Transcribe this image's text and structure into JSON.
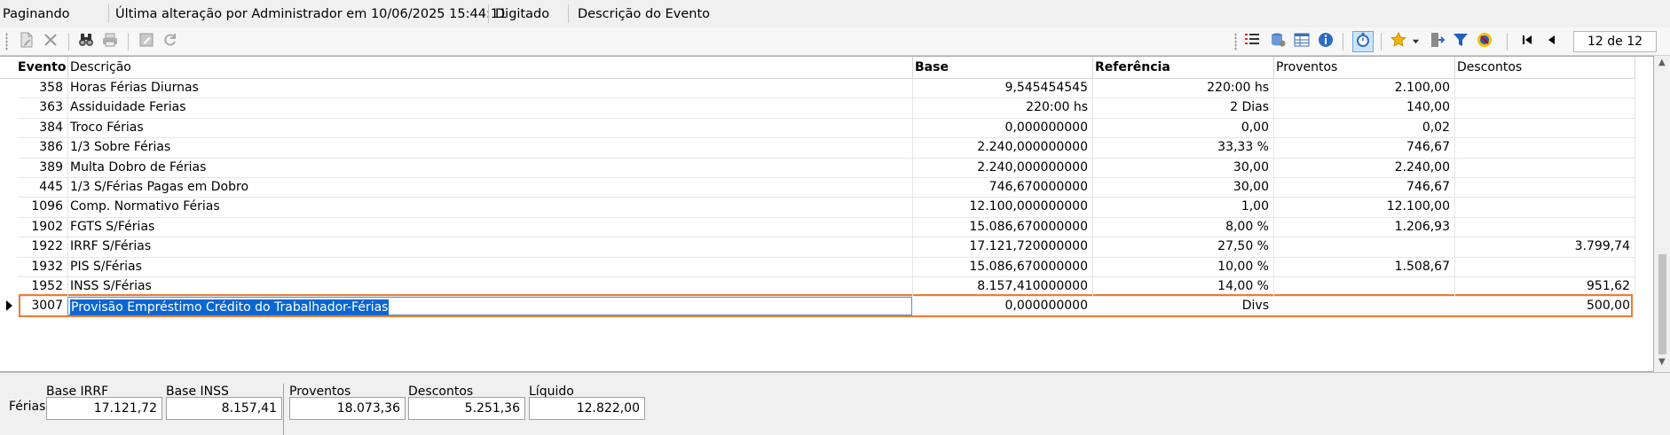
{
  "status": {
    "mode": "Paginando",
    "last_change": "Última alteração por Administrador em 10/06/2025 15:44:11",
    "state": "Digitado",
    "field": "Descrição do Evento"
  },
  "toolbar": {
    "page_indicator": "12 de 12"
  },
  "grid": {
    "headers": {
      "evento": "Evento",
      "descricao": "Descrição",
      "base": "Base",
      "referencia": "Referência",
      "proventos": "Proventos",
      "descontos": "Descontos"
    },
    "rows": [
      {
        "evento": "358",
        "descricao": "Horas Férias Diurnas",
        "base": "9,545454545",
        "referencia": "220:00 hs",
        "proventos": "2.100,00",
        "descontos": ""
      },
      {
        "evento": "363",
        "descricao": "Assiduidade Ferias",
        "base": "220:00 hs",
        "referencia": "2 Dias",
        "proventos": "140,00",
        "descontos": ""
      },
      {
        "evento": "384",
        "descricao": "Troco Férias",
        "base": "0,000000000",
        "referencia": "0,00",
        "proventos": "0,02",
        "descontos": ""
      },
      {
        "evento": "386",
        "descricao": "1/3 Sobre Férias",
        "base": "2.240,000000000",
        "referencia": "33,33 %",
        "proventos": "746,67",
        "descontos": ""
      },
      {
        "evento": "389",
        "descricao": "Multa Dobro de Férias",
        "base": "2.240,000000000",
        "referencia": "30,00",
        "proventos": "2.240,00",
        "descontos": ""
      },
      {
        "evento": "445",
        "descricao": "1/3 S/Férias Pagas em Dobro",
        "base": "746,670000000",
        "referencia": "30,00",
        "proventos": "746,67",
        "descontos": ""
      },
      {
        "evento": "1096",
        "descricao": "Comp. Normativo Férias",
        "base": "12.100,000000000",
        "referencia": "1,00",
        "proventos": "12.100,00",
        "descontos": ""
      },
      {
        "evento": "1902",
        "descricao": "FGTS S/Férias",
        "base": "15.086,670000000",
        "referencia": "8,00 %",
        "proventos": "1.206,93",
        "descontos": ""
      },
      {
        "evento": "1922",
        "descricao": "IRRF S/Férias",
        "base": "17.121,720000000",
        "referencia": "27,50 %",
        "proventos": "",
        "descontos": "3.799,74"
      },
      {
        "evento": "1932",
        "descricao": "PIS S/Férias",
        "base": "15.086,670000000",
        "referencia": "10,00 %",
        "proventos": "1.508,67",
        "descontos": ""
      },
      {
        "evento": "1952",
        "descricao": "INSS S/Férias",
        "base": "8.157,410000000",
        "referencia": "14,00 %",
        "proventos": "",
        "descontos": "951,62"
      },
      {
        "evento": "3007",
        "descricao": "Provisão Empréstimo Crédito do Trabalhador-Férias",
        "base": "0,000000000",
        "referencia": "Divs",
        "proventos": "",
        "descontos": "500,00"
      }
    ]
  },
  "summary": {
    "row_label": "Férias",
    "base_irrf_label": "Base IRRF",
    "base_irrf": "17.121,72",
    "base_inss_label": "Base INSS",
    "base_inss": "8.157,41",
    "proventos_label": "Proventos",
    "proventos": "18.073,36",
    "descontos_label": "Descontos",
    "descontos": "5.251,36",
    "liquido_label": "Líquido",
    "liquido": "12.822,00"
  },
  "colors": {
    "selection_outline": "#f07b2f",
    "edit_highlight": "#0a66d1"
  }
}
